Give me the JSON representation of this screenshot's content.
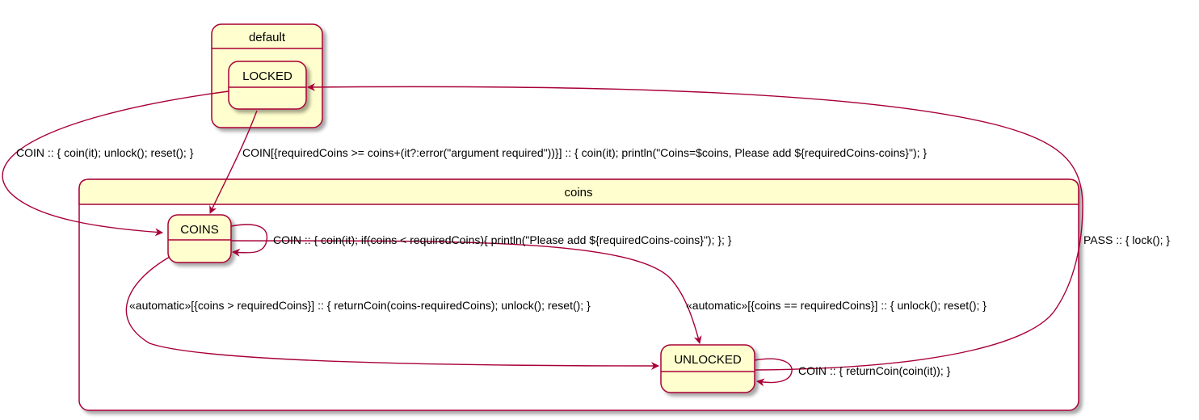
{
  "composites": {
    "default": {
      "title": "default"
    },
    "coins": {
      "title": "coins"
    }
  },
  "states": {
    "locked": "LOCKED",
    "coins": "COINS",
    "unlocked": "UNLOCKED"
  },
  "transitions": {
    "locked_to_coins_outer": "COIN :: { coin(it); unlock(); reset(); }",
    "locked_to_coins_state": "COIN[{requiredCoins >= coins+(it?:error(\"argument required\"))}] :: { coin(it); println(\"Coins=$coins, Please add ${requiredCoins-coins}\"); }",
    "coins_self": "COIN :: { coin(it); if(coins < requiredCoins){ println(\"Please add ${requiredCoins-coins}\"); }; }",
    "coins_to_unlocked_greater": "«automatic»[{coins > requiredCoins}] :: { returnCoin(coins-requiredCoins); unlock(); reset(); }",
    "coins_to_unlocked_equal": "«automatic»[{coins == requiredCoins}] :: { unlock(); reset(); }",
    "unlocked_self": "COIN :: { returnCoin(coin(it)); }",
    "unlocked_to_locked": "PASS :: { lock(); }"
  },
  "colors": {
    "fill": "#fefece",
    "border": "#a80036",
    "shadow": "#c8c8c8"
  }
}
